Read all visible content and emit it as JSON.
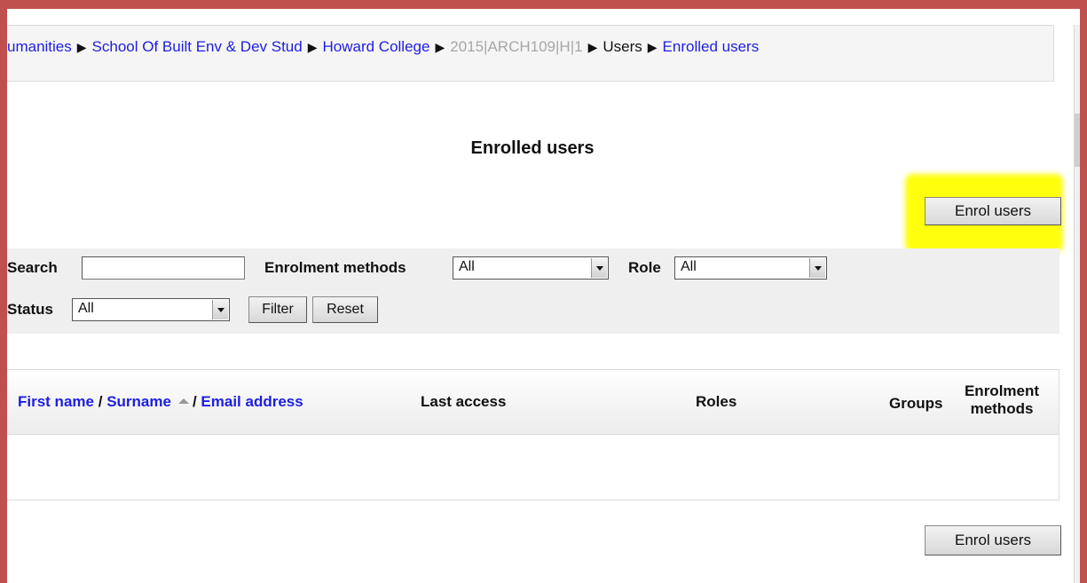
{
  "breadcrumb": {
    "items": [
      {
        "label": "umanities",
        "type": "link"
      },
      {
        "label": "School Of Built Env & Dev Stud",
        "type": "link"
      },
      {
        "label": "Howard College",
        "type": "link"
      },
      {
        "label": "2015|ARCH109|H|1",
        "type": "muted"
      },
      {
        "label": "Users",
        "type": "text"
      },
      {
        "label": "Enrolled users",
        "type": "link"
      }
    ]
  },
  "page": {
    "title": "Enrolled users",
    "enrol_button_top": "Enrol users",
    "enrol_button_bottom": "Enrol users"
  },
  "filters": {
    "search_label": "Search",
    "search_value": "",
    "enrolment_methods_label": "Enrolment methods",
    "enrolment_methods_value": "All",
    "role_label": "Role",
    "role_value": "All",
    "status_label": "Status",
    "status_value": "All",
    "filter_button": "Filter",
    "reset_button": "Reset"
  },
  "table": {
    "col_first_name": "First name",
    "col_separator1": "/",
    "col_surname": "Surname",
    "col_separator2": "/",
    "col_email": "Email address",
    "col_last_access": "Last access",
    "col_roles": "Roles",
    "col_groups": "Groups",
    "col_enrolment_line1": "Enrolment",
    "col_enrolment_line2": "methods"
  },
  "colors": {
    "frame": "#c0504d",
    "highlight": "#ffff00",
    "link": "#1d1ee0"
  }
}
